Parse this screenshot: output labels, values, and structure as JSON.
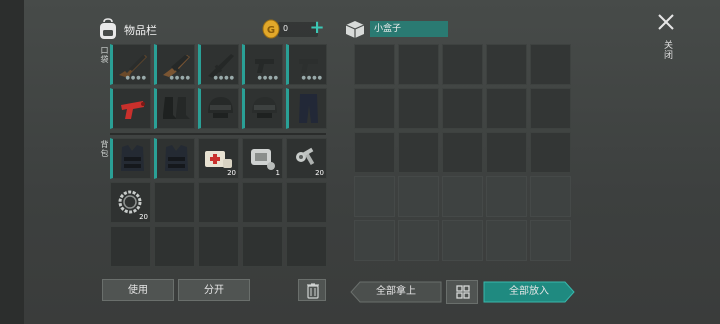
{
  "inventory": {
    "title": "物品栏",
    "coins": "0",
    "plus": "+",
    "section_pockets": "口袋",
    "section_backpack": "背包",
    "pocket_items": [
      {
        "name": "rifle",
        "qty": ""
      },
      {
        "name": "rifle",
        "qty": ""
      },
      {
        "name": "rifle",
        "qty": ""
      },
      {
        "name": "pistol",
        "qty": ""
      },
      {
        "name": "pistol",
        "qty": ""
      },
      {
        "name": "flare-gun",
        "qty": ""
      },
      {
        "name": "boots",
        "qty": ""
      },
      {
        "name": "helmet",
        "qty": ""
      },
      {
        "name": "helmet",
        "qty": ""
      },
      {
        "name": "pants",
        "qty": ""
      }
    ],
    "backpack_items": [
      {
        "name": "vest",
        "qty": ""
      },
      {
        "name": "vest",
        "qty": ""
      },
      {
        "name": "medkit",
        "qty": "20"
      },
      {
        "name": "parts",
        "qty": "1"
      },
      {
        "name": "nuts-bolts",
        "qty": "20"
      },
      {
        "name": "spring-coil",
        "qty": "20"
      }
    ]
  },
  "buttons": {
    "use": "使用",
    "split": "分开",
    "take_all": "全部拿上",
    "put_all": "全部放入"
  },
  "box": {
    "title": "小盒子"
  },
  "close": {
    "label": "关闭"
  },
  "colors": {
    "accent": "#2aa096",
    "coin": "#e2a82a"
  }
}
